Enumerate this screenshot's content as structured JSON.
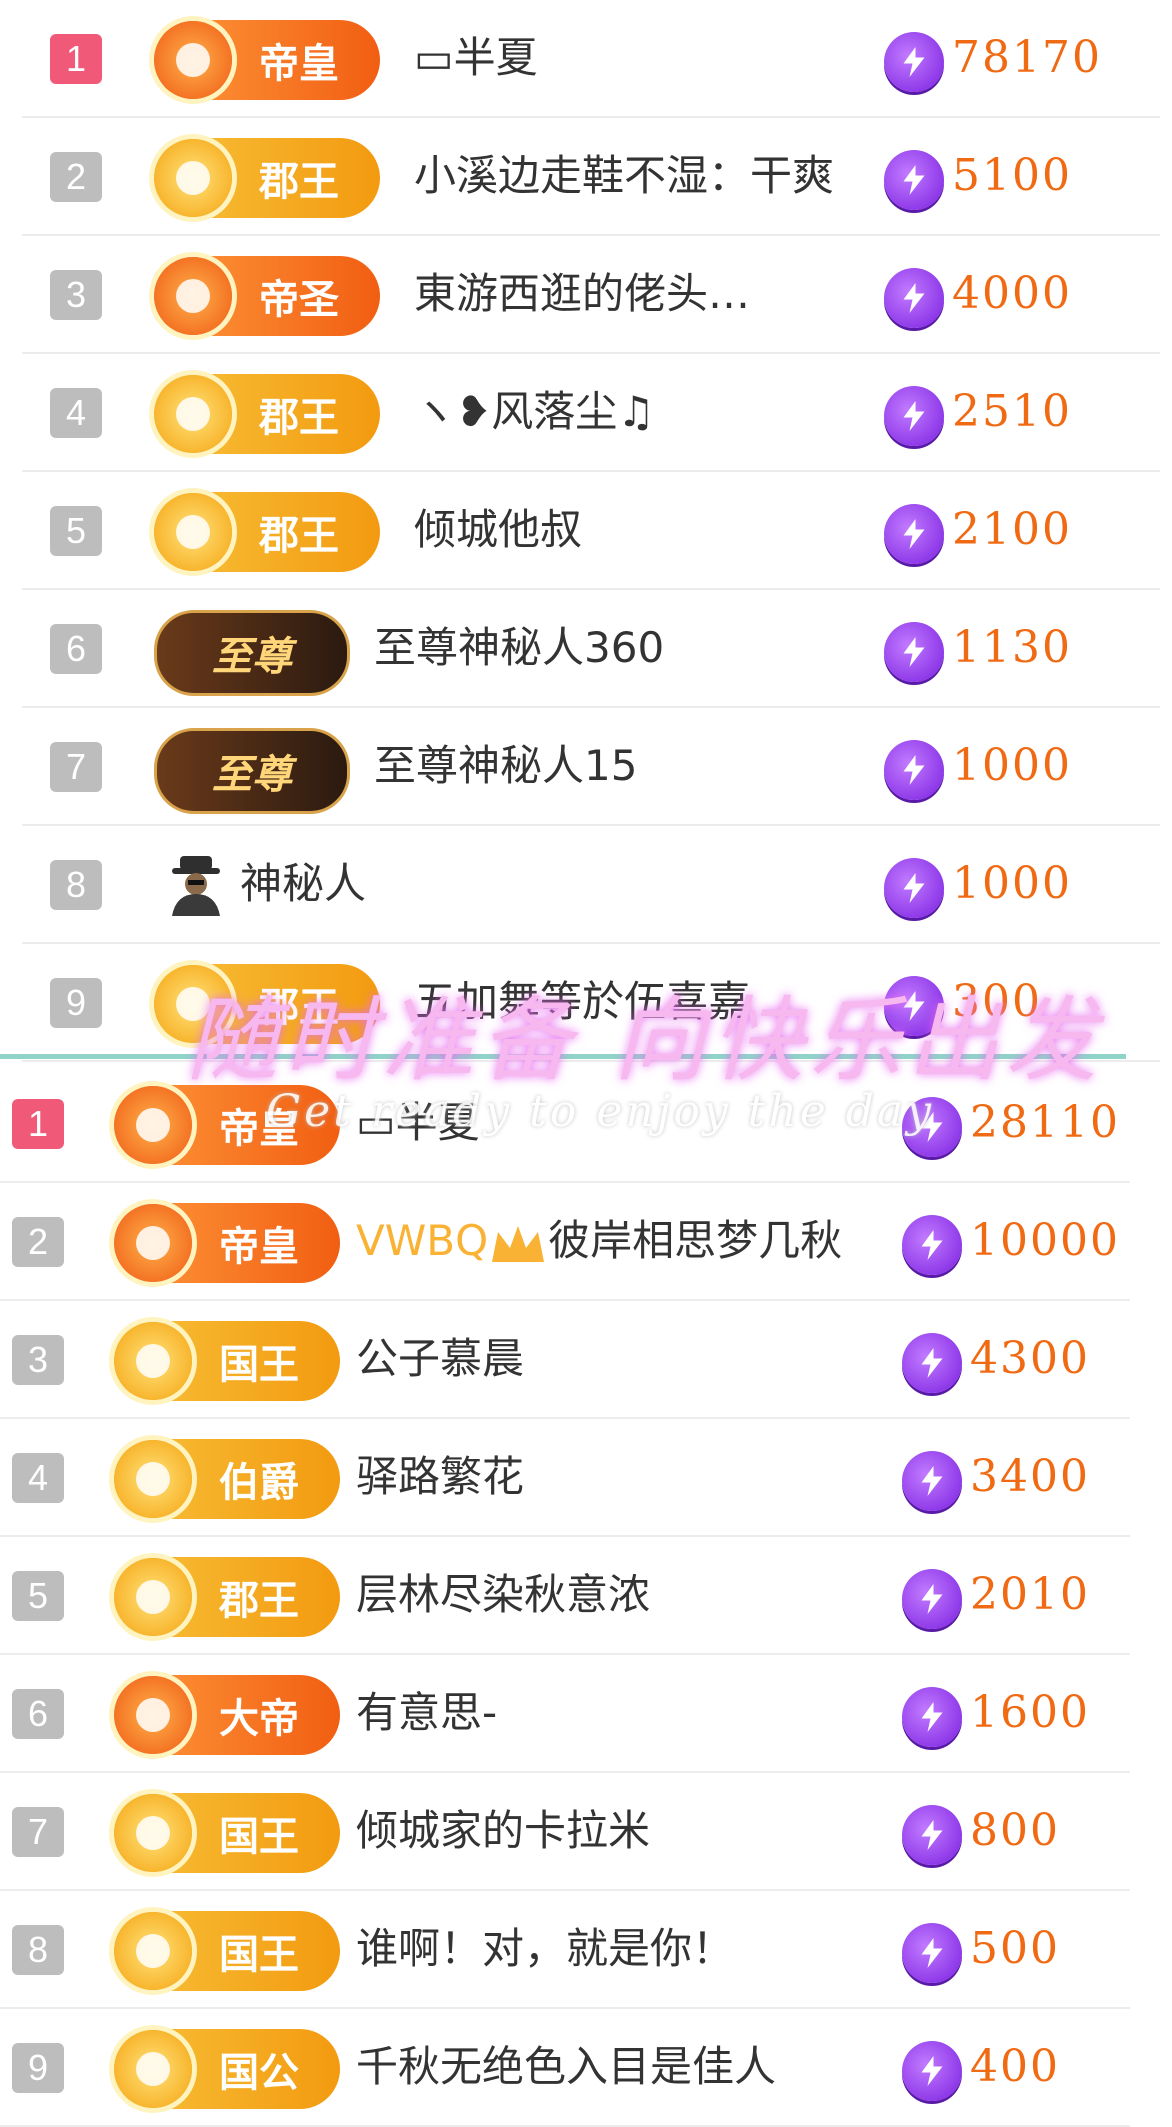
{
  "watermark": {
    "chinese": "随时准备 向快乐出发",
    "english": "Get ready to enjoy the day"
  },
  "list_a": [
    {
      "rank": "1",
      "badge": "帝皇",
      "badge_style": "orange",
      "name": "▭半夏",
      "score": "78170"
    },
    {
      "rank": "2",
      "badge": "郡王",
      "badge_style": "gold",
      "name": "小溪边走鞋不湿：干爽",
      "score": "5100"
    },
    {
      "rank": "3",
      "badge": "帝圣",
      "badge_style": "orange",
      "name": "東游西逛的佬头…",
      "score": "4000"
    },
    {
      "rank": "4",
      "badge": "郡王",
      "badge_style": "gold",
      "name": "ヽ❥风落尘♫",
      "score": "2510"
    },
    {
      "rank": "5",
      "badge": "郡王",
      "badge_style": "gold",
      "name": "倾城他叔",
      "score": "2100"
    },
    {
      "rank": "6",
      "badge": "至尊",
      "badge_style": "dark",
      "name": "至尊神秘人360",
      "score": "1130"
    },
    {
      "rank": "7",
      "badge": "至尊",
      "badge_style": "dark",
      "name": "至尊神秘人15",
      "score": "1000"
    },
    {
      "rank": "8",
      "badge": "",
      "badge_style": "avatar",
      "name": "神秘人",
      "score": "1000"
    },
    {
      "rank": "9",
      "badge": "郡王",
      "badge_style": "gold",
      "name": "五加舞等於伍喜嘉",
      "score": "300"
    }
  ],
  "list_b": [
    {
      "rank": "1",
      "badge": "帝皇",
      "badge_style": "orange",
      "name": "▭半夏",
      "score": "28110"
    },
    {
      "rank": "2",
      "badge": "帝皇",
      "badge_style": "orange",
      "name_prefix": "VWBQ",
      "name": "彼岸相思梦几秋",
      "score": "10000"
    },
    {
      "rank": "3",
      "badge": "国王",
      "badge_style": "gold",
      "name": "公子慕晨",
      "score": "4300"
    },
    {
      "rank": "4",
      "badge": "伯爵",
      "badge_style": "gold",
      "name": "驿路繁花",
      "score": "3400"
    },
    {
      "rank": "5",
      "badge": "郡王",
      "badge_style": "gold",
      "name": "层林尽染秋意浓",
      "score": "2010"
    },
    {
      "rank": "6",
      "badge": "大帝",
      "badge_style": "orange",
      "name": "有意思-",
      "score": "1600"
    },
    {
      "rank": "7",
      "badge": "国王",
      "badge_style": "gold",
      "name": "倾城家的卡拉米",
      "score": "800"
    },
    {
      "rank": "8",
      "badge": "国王",
      "badge_style": "gold",
      "name": "谁啊！对，就是你！",
      "score": "500"
    },
    {
      "rank": "9",
      "badge": "国公",
      "badge_style": "gold",
      "name": "千秋无绝色入目是佳人",
      "score": "400"
    }
  ],
  "icons": {
    "coin": "lightning-coin-icon",
    "avatar": "mystery-person-icon",
    "crown": "crown-icon"
  }
}
